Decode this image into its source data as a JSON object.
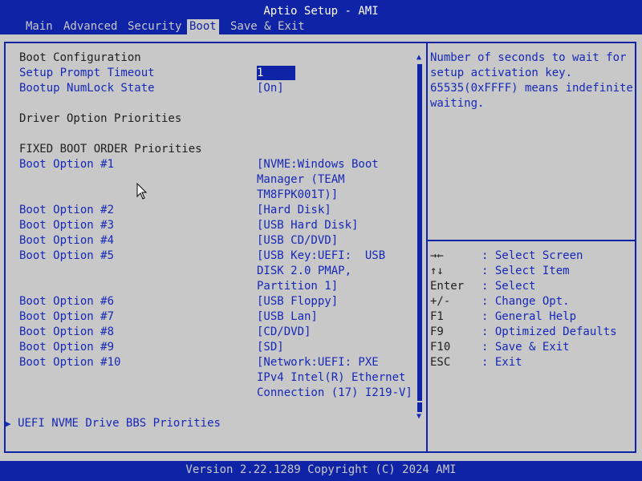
{
  "window": {
    "title": "Aptio Setup - AMI"
  },
  "menu": {
    "tabs": [
      {
        "label": "Main"
      },
      {
        "label": "Advanced"
      },
      {
        "label": "Security"
      },
      {
        "label": "Boot"
      },
      {
        "label": "Save & Exit"
      }
    ],
    "active": "Boot"
  },
  "boot": {
    "section_config": "Boot Configuration",
    "setup_prompt_label": "Setup Prompt Timeout",
    "setup_prompt_value": "1",
    "numlock_label": "Bootup NumLock State",
    "numlock_value": "[On]",
    "driver_priorities": "Driver Option Priorities",
    "fixed_order": "FIXED BOOT ORDER Priorities",
    "options": [
      {
        "label": "Boot Option #1",
        "value_lines": [
          "[NVME:Windows Boot",
          "Manager (TEAM",
          "TM8FPK001T)]"
        ]
      },
      {
        "label": "Boot Option #2",
        "value_lines": [
          "[Hard Disk]"
        ]
      },
      {
        "label": "Boot Option #3",
        "value_lines": [
          "[USB Hard Disk]"
        ]
      },
      {
        "label": "Boot Option #4",
        "value_lines": [
          "[USB CD/DVD]"
        ]
      },
      {
        "label": "Boot Option #5",
        "value_lines": [
          "[USB Key:UEFI:  USB",
          "DISK 2.0 PMAP,",
          "Partition 1]"
        ]
      },
      {
        "label": "Boot Option #6",
        "value_lines": [
          "[USB Floppy]"
        ]
      },
      {
        "label": "Boot Option #7",
        "value_lines": [
          "[USB Lan]"
        ]
      },
      {
        "label": "Boot Option #8",
        "value_lines": [
          "[CD/DVD]"
        ]
      },
      {
        "label": "Boot Option #9",
        "value_lines": [
          "[SD]"
        ]
      },
      {
        "label": "Boot Option #10",
        "value_lines": [
          "[Network:UEFI: PXE",
          "IPv4 Intel(R) Ethernet",
          "Connection (17) I219-V]"
        ]
      }
    ],
    "submenu_nvme": "UEFI NVME Drive BBS Priorities"
  },
  "help": {
    "lines": [
      "Number of seconds to wait for",
      "setup activation key.",
      "65535(0xFFFF) means indefinite",
      "waiting."
    ]
  },
  "keys": [
    {
      "key": "→←",
      "desc": ": Select Screen"
    },
    {
      "key": "↑↓",
      "desc": ": Select Item"
    },
    {
      "key": "Enter",
      "desc": ": Select"
    },
    {
      "key": "+/-",
      "desc": ": Change Opt."
    },
    {
      "key": "F1",
      "desc": ": General Help"
    },
    {
      "key": "F9",
      "desc": ": Optimized Defaults"
    },
    {
      "key": "F10",
      "desc": ": Save & Exit"
    },
    {
      "key": "ESC",
      "desc": ": Exit"
    }
  ],
  "footer": {
    "version": "Version 2.22.1289 Copyright (C) 2024 AMI"
  },
  "colors": {
    "background": "#0f23a6",
    "panel": "#c8c8c8",
    "text_blue": "#1628b8",
    "text_dark": "#202020"
  }
}
